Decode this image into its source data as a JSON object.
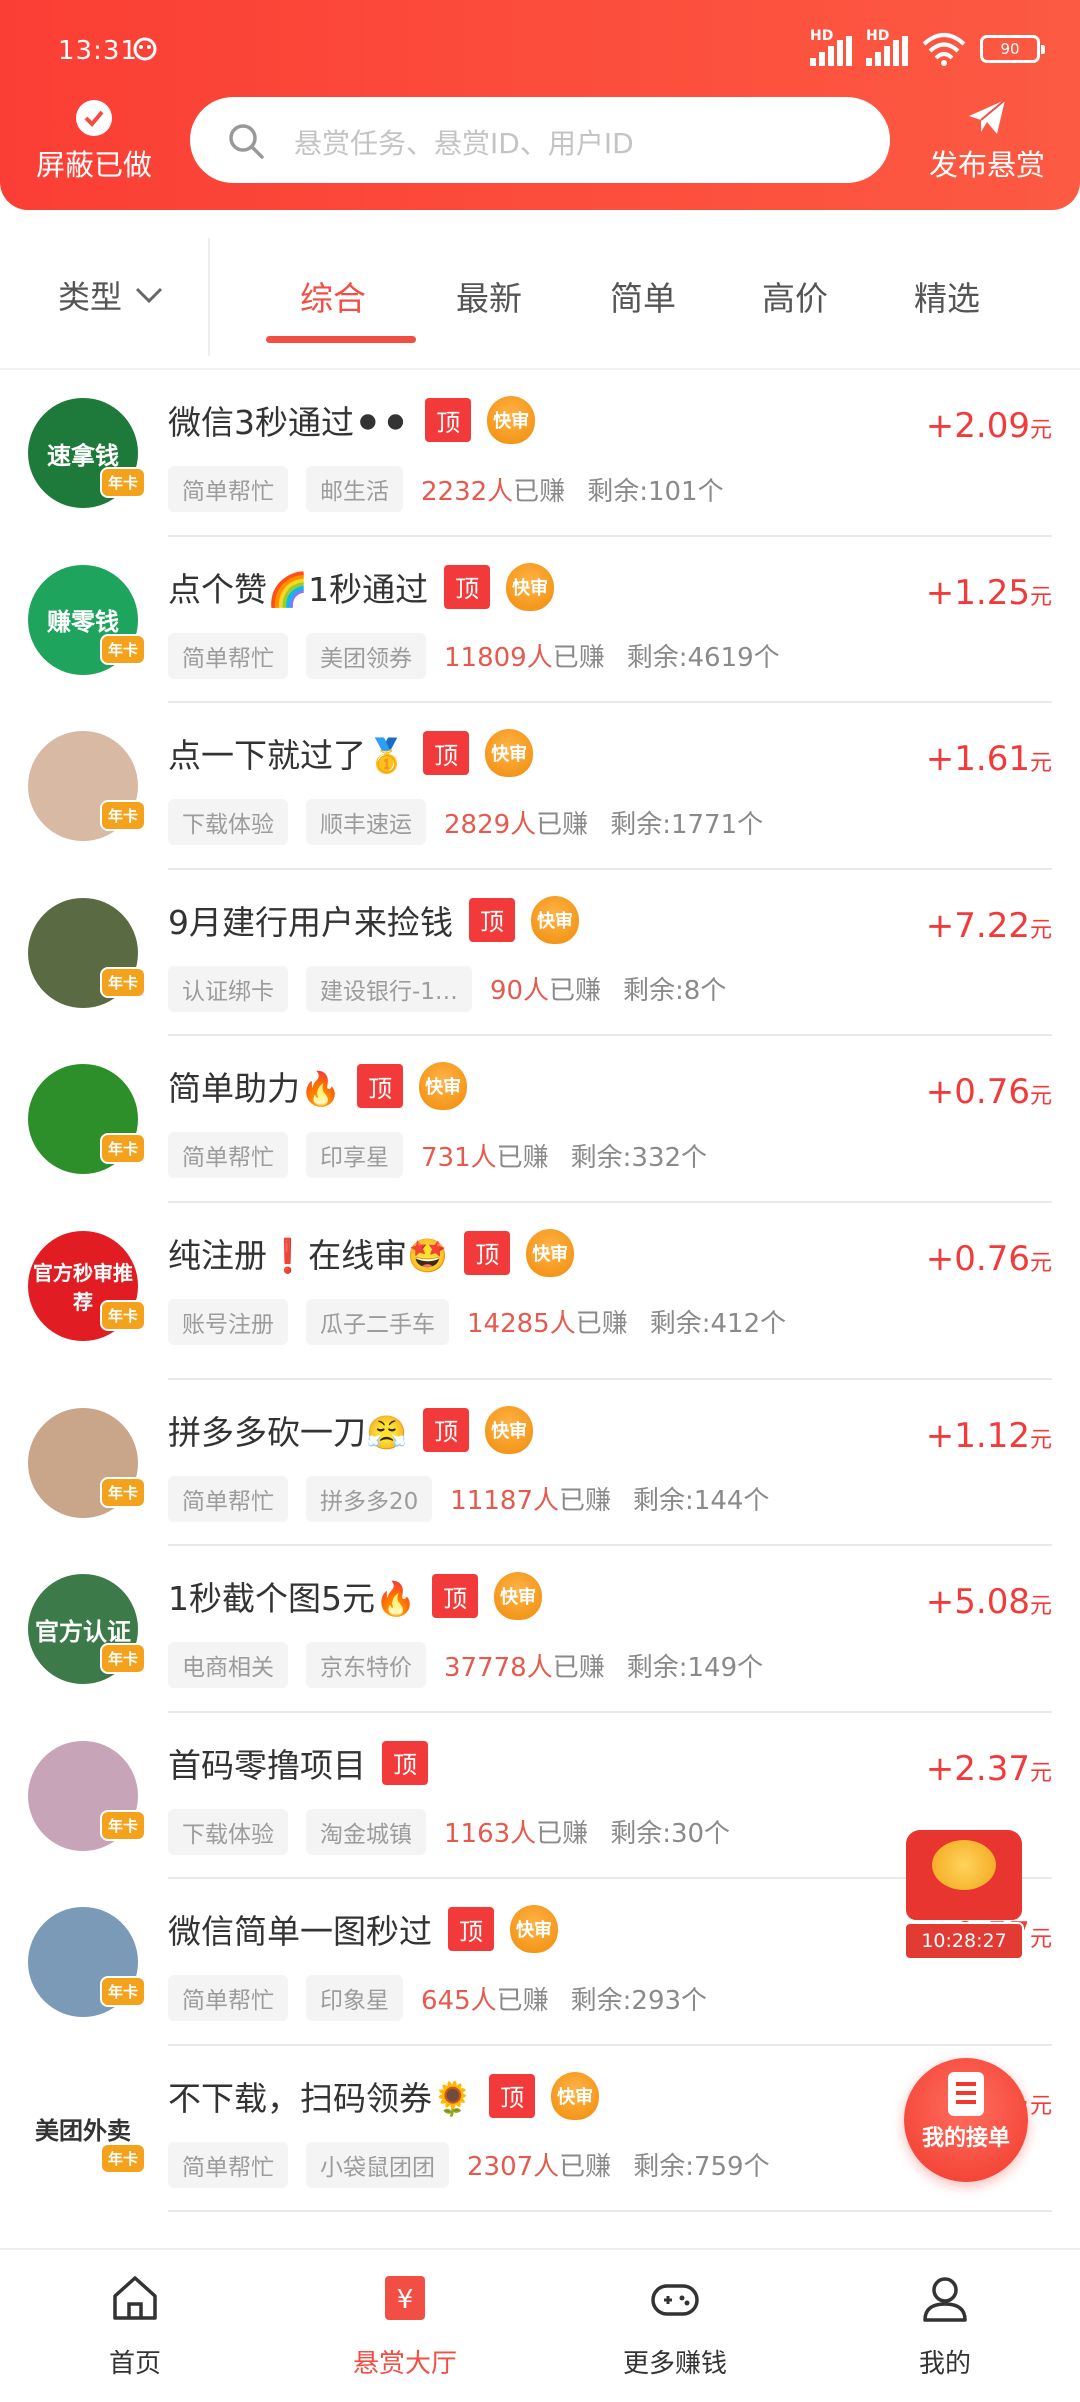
{
  "status_bar": {
    "time": "13:31",
    "battery": "90",
    "signal_label": "HD"
  },
  "header": {
    "shield_label": "屏蔽已做",
    "search_placeholder": "悬赏任务、悬赏ID、用户ID",
    "publish_label": "发布悬赏"
  },
  "filter": {
    "type_label": "类型",
    "tabs": [
      "综合",
      "最新",
      "简单",
      "高价",
      "精选"
    ],
    "active_tab": "综合"
  },
  "tasks": [
    {
      "title": "微信3秒通过⚫⚫",
      "top": "顶",
      "fast": "快审",
      "tag1": "简单帮忙",
      "tag2": "邮生活",
      "earned": "2232人",
      "earned_label": "已赚",
      "remaining": "剩余:101个",
      "price": "+2.09",
      "unit": "元",
      "avatar_text": "速拿钱",
      "avatar_color": "#1e7a3a",
      "badge": "年卡"
    },
    {
      "title": "点个赞🌈1秒通过",
      "top": "顶",
      "fast": "快审",
      "tag1": "简单帮忙",
      "tag2": "美团领券",
      "earned": "11809人",
      "earned_label": "已赚",
      "remaining": "剩余:4619个",
      "price": "+1.25",
      "unit": "元",
      "avatar_text": "赚零钱",
      "avatar_color": "#1fa45e",
      "badge": "年卡"
    },
    {
      "title": "点一下就过了🥇",
      "top": "顶",
      "fast": "快审",
      "tag1": "下载体验",
      "tag2": "顺丰速运",
      "earned": "2829人",
      "earned_label": "已赚",
      "remaining": "剩余:1771个",
      "price": "+1.61",
      "unit": "元",
      "avatar_text": "",
      "avatar_color": "#d8b9a3",
      "badge": "年卡"
    },
    {
      "title": "9月建行用户来捡钱",
      "top": "顶",
      "fast": "快审",
      "tag1": "认证绑卡",
      "tag2": "建设银行-1…",
      "earned": "90人",
      "earned_label": "已赚",
      "remaining": "剩余:8个",
      "price": "+7.22",
      "unit": "元",
      "avatar_text": "",
      "avatar_color": "#5a6b43",
      "badge": "年卡"
    },
    {
      "title": "简单助力🔥",
      "top": "顶",
      "fast": "快审",
      "tag1": "简单帮忙",
      "tag2": "印享星",
      "earned": "731人",
      "earned_label": "已赚",
      "remaining": "剩余:332个",
      "price": "+0.76",
      "unit": "元",
      "avatar_text": "",
      "avatar_color": "#2d8f2a",
      "badge": "年卡"
    },
    {
      "title": "纯注册❗在线审🤩",
      "top": "顶",
      "fast": "快审",
      "tag1": "账号注册",
      "tag2": "瓜子二手车",
      "earned": "14285人",
      "earned_label": "已赚",
      "remaining": "剩余:412个",
      "price": "+0.76",
      "unit": "元",
      "avatar_text": "官方秒审推荐",
      "avatar_color": "#e11d23",
      "badge": "年卡"
    },
    {
      "title": "拼多多砍一刀😤",
      "top": "顶",
      "fast": "快审",
      "tag1": "简单帮忙",
      "tag2": "拼多多20",
      "earned": "11187人",
      "earned_label": "已赚",
      "remaining": "剩余:144个",
      "price": "+1.12",
      "unit": "元",
      "avatar_text": "",
      "avatar_color": "#c9a58a",
      "badge": "年卡"
    },
    {
      "title": "1秒截个图5元🔥",
      "top": "顶",
      "fast": "快审",
      "tag1": "电商相关",
      "tag2": "京东特价",
      "earned": "37778人",
      "earned_label": "已赚",
      "remaining": "剩余:149个",
      "price": "+5.08",
      "unit": "元",
      "avatar_text": "官方认证",
      "avatar_color": "#3c7a4a",
      "badge": "年卡"
    },
    {
      "title": "首码零撸项目",
      "top": "顶",
      "fast": "",
      "tag1": "下载体验",
      "tag2": "淘金城镇",
      "earned": "1163人",
      "earned_label": "已赚",
      "remaining": "剩余:30个",
      "price": "+2.37",
      "unit": "元",
      "avatar_text": "",
      "avatar_color": "#c7a4b8",
      "badge": "年卡"
    },
    {
      "title": "微信简单一图秒过",
      "top": "顶",
      "fast": "快审",
      "tag1": "简单帮忙",
      "tag2": "印象星",
      "earned": "645人",
      "earned_label": "已赚",
      "remaining": "剩余:293个",
      "price": "+0.57",
      "unit": "元",
      "avatar_text": "",
      "avatar_color": "#7a9ab8",
      "badge": "年卡"
    },
    {
      "title": "不下载，扫码领券🌻",
      "top": "顶",
      "fast": "快审",
      "tag1": "简单帮忙",
      "tag2": "小袋鼠团团",
      "earned": "2307人",
      "earned_label": "已赚",
      "remaining": "剩余:759个",
      "price": "+",
      "unit": "元",
      "avatar_text": "美团外卖",
      "avatar_color": "#ffffff",
      "badge": "年卡"
    }
  ],
  "floating": {
    "timer": "10:28:27",
    "orders_label": "我的接单"
  },
  "bottom_nav": [
    {
      "label": "首页",
      "icon": "home-icon"
    },
    {
      "label": "悬赏大厅",
      "icon": "reward-hall-icon"
    },
    {
      "label": "更多赚钱",
      "icon": "gamepad-icon"
    },
    {
      "label": "我的",
      "icon": "user-icon"
    }
  ],
  "colors": {
    "brand": "#f24e43",
    "price": "#f23a3a",
    "header_start": "#fb3e35",
    "header_end": "#fc5a42"
  }
}
